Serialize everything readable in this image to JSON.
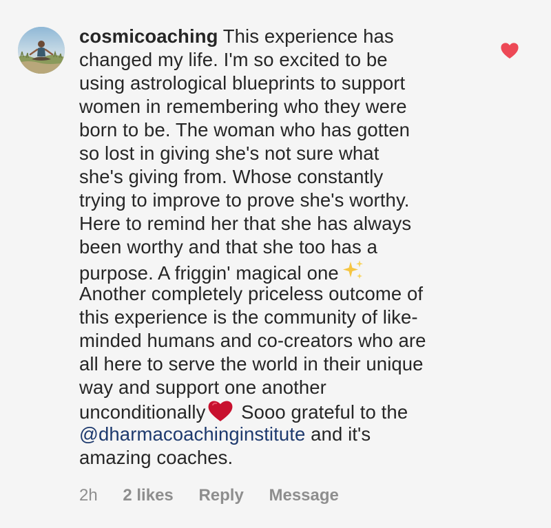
{
  "comment": {
    "username": "cosmicoaching",
    "lines": [
      " This experience has",
      "changed my life. I'm so excited to be",
      "using astrological blueprints to support",
      "women in remembering who they were",
      "born to be. The woman who has gotten",
      "so lost in giving she's not sure what",
      "she's giving from. Whose constantly",
      "trying to improve to prove she's worthy.",
      "Here to remind her that she has always",
      "been worthy and that she too has a",
      "purpose. A friggin' magical one",
      "Another completely priceless outcome of",
      "this experience is the community of like-",
      "minded humans and co-creators who are",
      "all here to serve the world in their unique",
      "way and support one another",
      "unconditionally",
      " Sooo grateful to the",
      "@dharmacoachinginstitute",
      " and it's",
      "amazing coaches."
    ],
    "time": "2h",
    "likes": "2 likes",
    "reply_label": "Reply",
    "message_label": "Message",
    "like_icon": "heart-filled-icon",
    "like_color": "#ed4956",
    "mention_color": "#1e3a6e",
    "emojis": [
      "sparkles-emoji",
      "red-heart-emoji"
    ]
  }
}
